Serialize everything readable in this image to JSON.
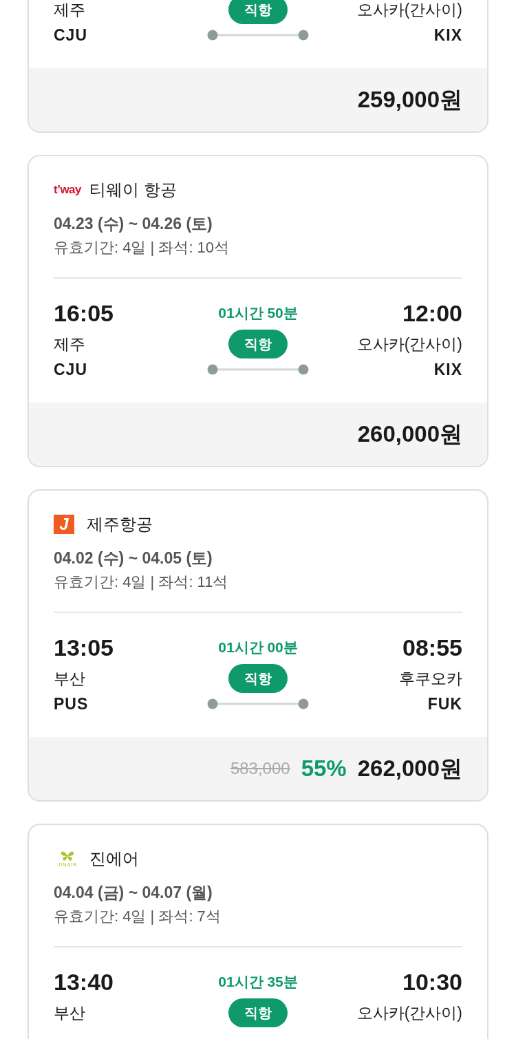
{
  "flights": [
    {
      "route": {
        "from_city": "제주",
        "from_code": "CJU",
        "badge": "직항",
        "to_city": "오사카(간사이)",
        "to_code": "KIX"
      },
      "price": {
        "amount": "259,000원"
      }
    },
    {
      "airline": {
        "kind": "tway",
        "logo_text": "t’way",
        "name": "티웨이 항공"
      },
      "dates": "04.23 (수) ~ 04.26 (토)",
      "validity": "유효기간: 4일 | 좌석: 10석",
      "route": {
        "depart_time": "16:05",
        "duration": "01시간 50분",
        "arrive_time": "12:00",
        "from_city": "제주",
        "from_code": "CJU",
        "badge": "직항",
        "to_city": "오사카(간사이)",
        "to_code": "KIX"
      },
      "price": {
        "amount": "260,000원"
      }
    },
    {
      "airline": {
        "kind": "jeju",
        "logo_text": "J",
        "name": "제주항공"
      },
      "dates": "04.02 (수) ~ 04.05 (토)",
      "validity": "유효기간: 4일 | 좌석: 11석",
      "route": {
        "depart_time": "13:05",
        "duration": "01시간 00분",
        "arrive_time": "08:55",
        "from_city": "부산",
        "from_code": "PUS",
        "badge": "직항",
        "to_city": "후쿠오카",
        "to_code": "FUK"
      },
      "price": {
        "original": "583,000",
        "discount": "55%",
        "amount": "262,000원"
      }
    },
    {
      "airline": {
        "kind": "jinair",
        "logo_text": "JINAIR",
        "name": "진에어"
      },
      "dates": "04.04 (금) ~ 04.07 (월)",
      "validity": "유효기간: 4일 | 좌석: 7석",
      "route": {
        "depart_time": "13:40",
        "duration": "01시간 35분",
        "arrive_time": "10:30",
        "from_city": "부산",
        "badge": "직항",
        "to_city": "오사카(간사이)"
      }
    }
  ]
}
